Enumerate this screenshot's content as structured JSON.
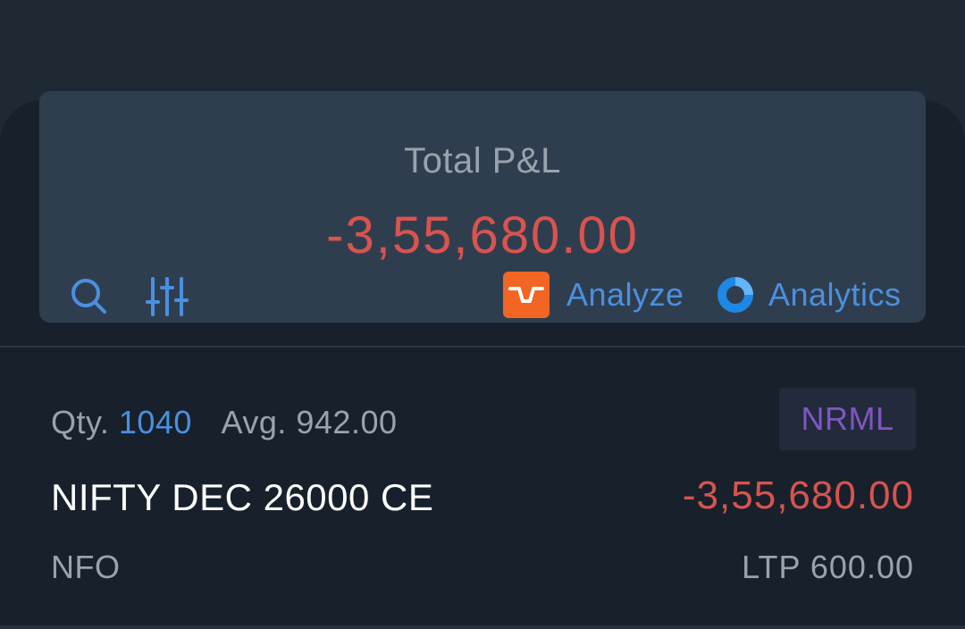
{
  "summary": {
    "label": "Total P&L",
    "value": "-3,55,680.00"
  },
  "toolbar": {
    "search_icon": "search-icon",
    "filter_icon": "sliders-icon",
    "analyze_label": "Analyze",
    "analytics_label": "Analytics"
  },
  "positions": [
    {
      "qty_label": "Qty.",
      "qty": "1040",
      "avg_label": "Avg.",
      "avg": "942.00",
      "product": "NRML",
      "symbol": "NIFTY DEC 26000 CE",
      "pnl": "-3,55,680.00",
      "exchange": "NFO",
      "ltp_label": "LTP",
      "ltp": "600.00"
    }
  ],
  "colors": {
    "loss": "#d9534f",
    "accent": "#4a90e2",
    "product_badge": "#7e57c2",
    "analyze_brand": "#f26522"
  }
}
